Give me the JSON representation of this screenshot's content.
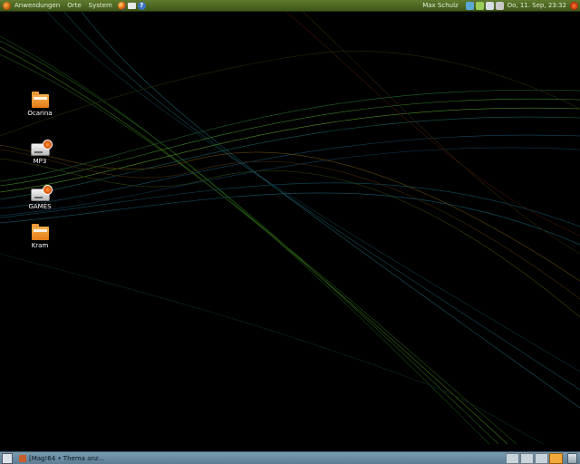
{
  "top_panel": {
    "menus": [
      "Anwendungen",
      "Orte",
      "System"
    ],
    "user_name": "Max Schulz",
    "clock": "Do, 11. Sep, 23:32",
    "launcher_icons": [
      "firefox-icon",
      "mail-icon",
      "help-icon"
    ],
    "tray_icons": [
      "network-icon",
      "update-notifier-icon",
      "display-icon",
      "volume-icon"
    ]
  },
  "desktop": {
    "icons": [
      {
        "label": "Ocarina",
        "type": "folder-icon"
      },
      {
        "label": "MP3",
        "type": "drive-icon"
      },
      {
        "label": "GAMES",
        "type": "drive-icon"
      },
      {
        "label": "Kram",
        "type": "folder-icon"
      }
    ]
  },
  "bottom_panel": {
    "task": "[Mag!64 • Thema anz...",
    "workspaces": 4,
    "active_workspace": 4
  },
  "colors": {
    "panel_top": "#4e6a22",
    "panel_bottom": "#6b8ca3",
    "desktop_bg": "#000000",
    "folder": "#ee9424"
  }
}
